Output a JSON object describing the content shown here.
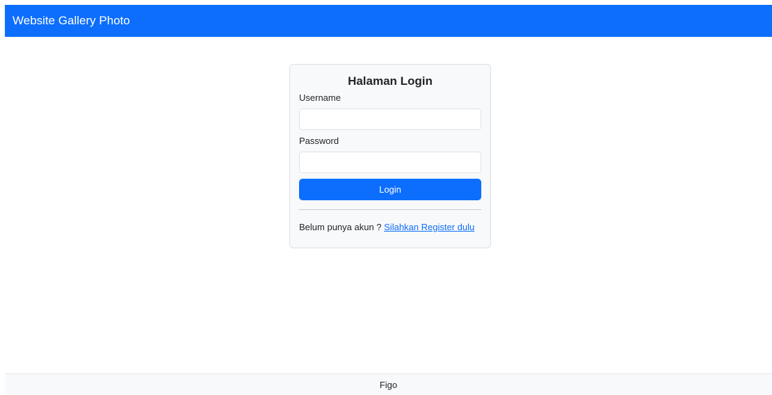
{
  "navbar": {
    "brand": "Website Gallery Photo",
    "color": "#0d6efd"
  },
  "login_card": {
    "title": "Halaman Login",
    "username_label": "Username",
    "username_value": "",
    "password_label": "Password",
    "password_value": "",
    "login_button": "Login",
    "register_prompt": "Belum punya akun ? ",
    "register_link": "Silahkan Register dulu"
  },
  "footer": {
    "text": "Figo"
  }
}
